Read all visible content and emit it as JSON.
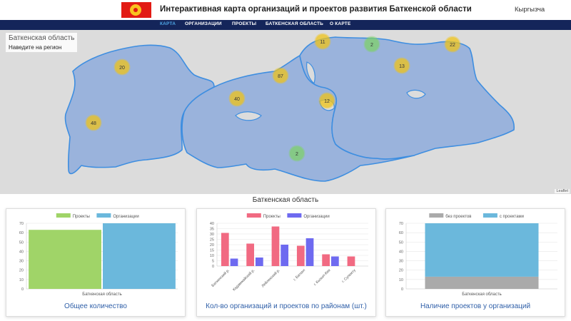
{
  "header": {
    "title": "Интерактивная карта организаций и проектов развития Баткенской области",
    "language": "Кыргызча"
  },
  "nav": {
    "items": [
      "КАРТА",
      "ОРГАНИЗАЦИИ",
      "ПРОЕКТЫ",
      "БАТКЕНСКАЯ ОБЛАСТЬ",
      "О КАРТЕ"
    ],
    "active": "КАРТА"
  },
  "map": {
    "region_name": "Баткенская область",
    "hint": "Наведите на регион",
    "attribution": "Leaflet",
    "clusters": [
      {
        "label": "20",
        "color": "#f0c419"
      },
      {
        "label": "48",
        "color": "#f0c419"
      },
      {
        "label": "87",
        "color": "#f0c419"
      },
      {
        "label": "40",
        "color": "#f0c419"
      },
      {
        "label": "11",
        "color": "#f0c419"
      },
      {
        "label": "2",
        "color": "#7fd16a"
      },
      {
        "label": "13",
        "color": "#f0c419"
      },
      {
        "label": "22",
        "color": "#f0c419"
      },
      {
        "label": "12",
        "color": "#f0c419"
      },
      {
        "label": "2",
        "color": "#7fd16a"
      }
    ]
  },
  "section_title": "Баткенская область",
  "charts": {
    "total": {
      "title": "Общее количество"
    },
    "districts": {
      "title": "Кол-во организаций и проектов по районам (шт.)"
    },
    "presence": {
      "title": "Наличие проектов у организаций"
    }
  },
  "chart_data": [
    {
      "type": "bar",
      "categories": [
        "Баткенская область"
      ],
      "series": [
        {
          "name": "Проекты",
          "values": [
            63
          ],
          "color": "#a0d468"
        },
        {
          "name": "Организации",
          "values": [
            70
          ],
          "color": "#6bb8dc"
        }
      ],
      "ylim": [
        0,
        70
      ],
      "yticks": [
        0,
        10,
        20,
        30,
        40,
        50,
        60,
        70
      ],
      "legend": "top"
    },
    {
      "type": "bar",
      "categories": [
        "Баткенский р.",
        "Кадамжайский р.",
        "Лейлекский р.",
        "г. Баткен",
        "г. Кызыл-Кия",
        "г. Сулюкту"
      ],
      "series": [
        {
          "name": "Проекты",
          "values": [
            31,
            21,
            37,
            19,
            11,
            9
          ],
          "color": "#f16a82"
        },
        {
          "name": "Организации",
          "values": [
            7,
            8,
            20,
            26,
            9,
            0
          ],
          "color": "#6e6af0"
        }
      ],
      "ylim": [
        0,
        40
      ],
      "yticks": [
        0,
        5,
        10,
        15,
        20,
        25,
        30,
        35,
        40
      ],
      "legend": "top"
    },
    {
      "type": "bar",
      "stacked": true,
      "categories": [
        "Баткенская область"
      ],
      "series": [
        {
          "name": "без проектов",
          "values": [
            13
          ],
          "color": "#aaaaaa"
        },
        {
          "name": "с проектами",
          "values": [
            57
          ],
          "color": "#6bb8dc"
        }
      ],
      "ylim": [
        0,
        70
      ],
      "yticks": [
        0,
        10,
        20,
        30,
        40,
        50,
        60,
        70
      ],
      "legend": "top"
    }
  ]
}
